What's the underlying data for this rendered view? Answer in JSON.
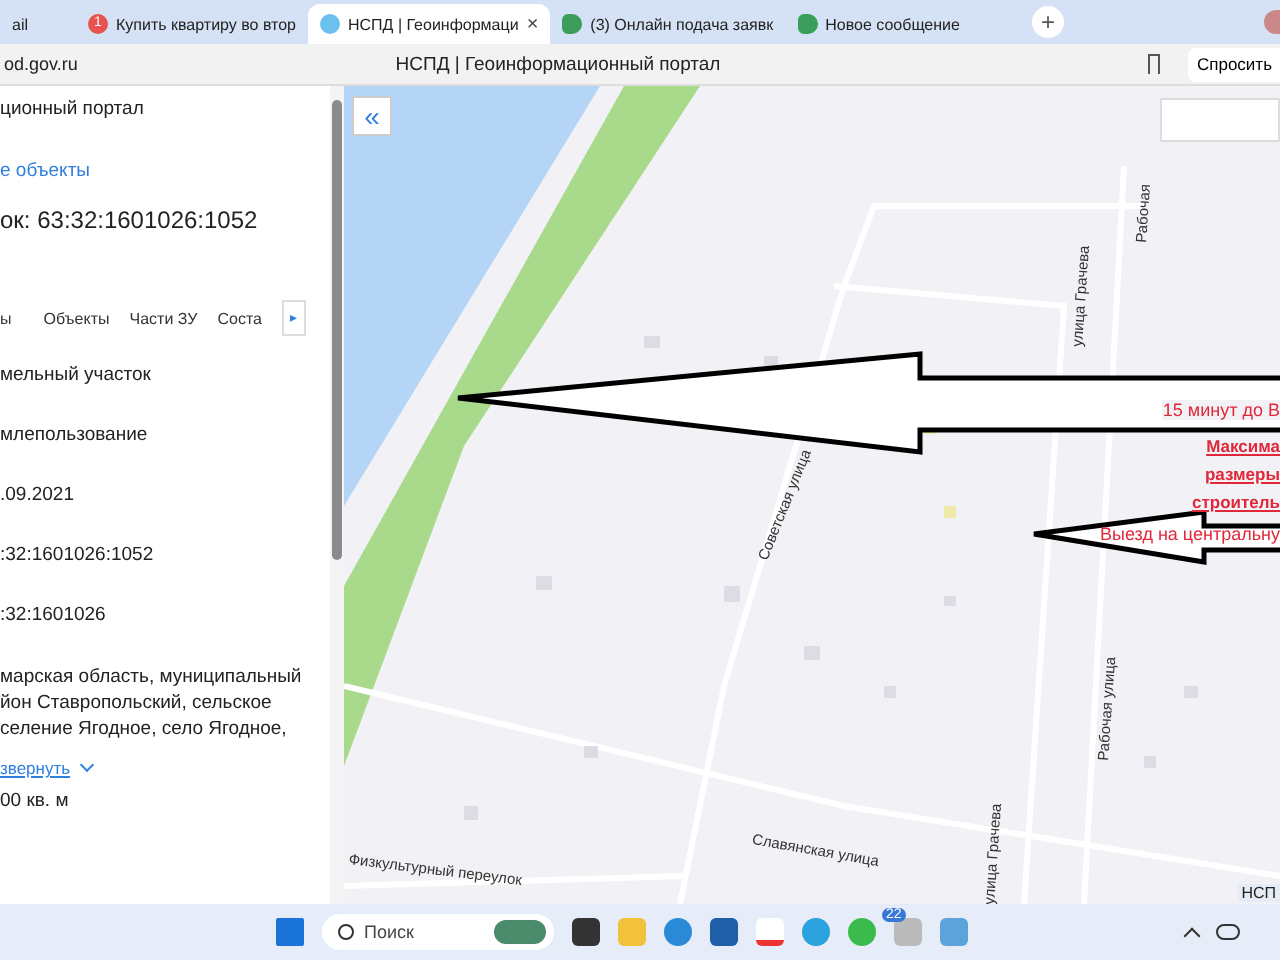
{
  "browser_tabs": [
    {
      "title": "ail",
      "selected": false,
      "kind": "plain"
    },
    {
      "title": "Купить квартиру во втор",
      "selected": false,
      "kind": "badged",
      "badge": "1"
    },
    {
      "title": "НСПД | Геоинформаци",
      "selected": true,
      "kind": "portal",
      "close": "×"
    },
    {
      "title": "(3) Онлайн подача заявк",
      "selected": false,
      "kind": "messenger"
    },
    {
      "title": "Новое сообщение",
      "selected": false,
      "kind": "messenger"
    }
  ],
  "new_tab": "+",
  "address_bar": {
    "url": "od.gov.ru",
    "page_title": "НСПД | Геоинформационный портал",
    "ask_button": "Спросить"
  },
  "panel": {
    "portal": "ционный портал",
    "link": "е объекты",
    "heading": "ок: 63:32:1601026:1052",
    "tabs": [
      {
        "label": "ы",
        "selected": false
      },
      {
        "label": "Объекты",
        "selected": false
      },
      {
        "label": "Части ЗУ",
        "selected": false
      },
      {
        "label": "Соста",
        "selected": false
      }
    ],
    "tabs_next": "▸",
    "fields": [
      {
        "kind": "text",
        "value": "мельный участок"
      },
      {
        "kind": "text",
        "value": "млепользование"
      },
      {
        "kind": "text",
        "value": ".09.2021"
      },
      {
        "kind": "text",
        "value": ":32:1601026:1052"
      },
      {
        "kind": "text",
        "value": ":32:1601026"
      },
      {
        "kind": "address",
        "value": "марская область, муниципальный йон Ставропольский, сельское селение Ягодное, село Ягодное,",
        "toggle": "звернуть"
      },
      {
        "kind": "text",
        "value": "00 кв. м"
      }
    ]
  },
  "map": {
    "collapse_button": "«",
    "streets": [
      {
        "name": "Советская улица",
        "kind": "steep"
      },
      {
        "name": "улица Грачева",
        "kind": "top1"
      },
      {
        "name": "Рабочая",
        "kind": "top2"
      },
      {
        "name": "Славянская улица",
        "kind": "main"
      },
      {
        "name": "Физкультурный переулок",
        "kind": "lane"
      },
      {
        "name": "Рабочая улица",
        "kind": "bottom1"
      },
      {
        "name": "улица Грачева",
        "kind": "bottom2"
      }
    ],
    "notes": [
      {
        "text": "15 минут до В",
        "kind": "plain"
      },
      {
        "text": "Максима",
        "kind": "underline"
      },
      {
        "text": "размеры",
        "kind": "underline"
      },
      {
        "text": "строитель",
        "kind": "underline"
      },
      {
        "text": "Выезд на центральну",
        "kind": "plain"
      }
    ],
    "corner_label": "НСП"
  },
  "taskbar": {
    "search": "Поиск",
    "badge": "22"
  }
}
